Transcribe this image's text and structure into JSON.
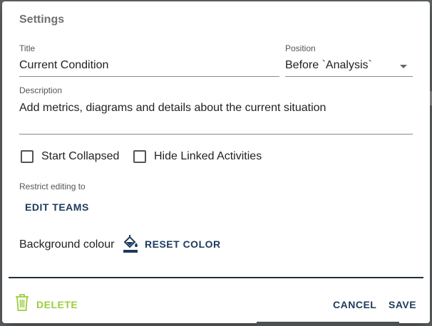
{
  "dialog": {
    "title": "Settings"
  },
  "form": {
    "title_label": "Title",
    "title_value": "Current Condition",
    "position_label": "Position",
    "position_value": "Before `Analysis`",
    "description_label": "Description",
    "description_value": "Add metrics, diagrams and details about the current situation",
    "start_collapsed_label": "Start Collapsed",
    "hide_linked_label": "Hide Linked Activities",
    "restrict_label": "Restrict editing to",
    "edit_teams_label": "EDIT TEAMS",
    "background_label": "Background colour",
    "reset_color_label": "RESET COLOR"
  },
  "footer": {
    "delete_label": "DELETE",
    "cancel_label": "CANCEL",
    "save_label": "SAVE"
  },
  "colors": {
    "accent_navy": "#1d3a5c",
    "delete_green": "#9ccc3a",
    "divider": "#1f2f3e"
  },
  "icons": [
    "chevron-down-icon",
    "paint-bucket-icon",
    "trash-icon",
    "checkbox-empty-icon"
  ]
}
